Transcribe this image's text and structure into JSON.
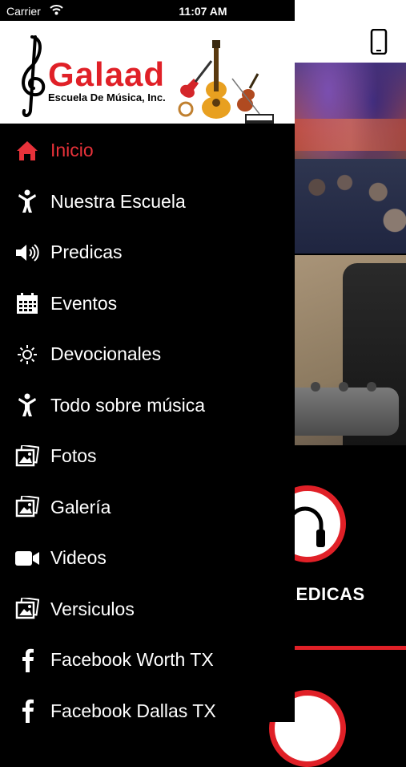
{
  "status_bar": {
    "carrier": "Carrier",
    "time": "11:07 AM"
  },
  "logo": {
    "name": "Galaad",
    "subtitle": "Escuela De Música, Inc."
  },
  "menu": [
    {
      "label": "Inicio",
      "icon": "home-icon",
      "active": true
    },
    {
      "label": "Nuestra Escuela",
      "icon": "person-icon"
    },
    {
      "label": "Predicas",
      "icon": "speaker-icon"
    },
    {
      "label": "Eventos",
      "icon": "calendar-icon"
    },
    {
      "label": "Devocionales",
      "icon": "sun-icon"
    },
    {
      "label": "Todo sobre música",
      "icon": "person-icon"
    },
    {
      "label": "Fotos",
      "icon": "photos-icon"
    },
    {
      "label": "Galería",
      "icon": "photos-icon"
    },
    {
      "label": "Videos",
      "icon": "video-camera-icon"
    },
    {
      "label": "Versiculos",
      "icon": "photos-icon"
    },
    {
      "label": "Facebook Worth TX",
      "icon": "facebook-icon"
    },
    {
      "label": "Facebook Dallas TX",
      "icon": "facebook-icon"
    }
  ],
  "background": {
    "section_label": "PREDICAS"
  },
  "colors": {
    "accent": "#e8323a",
    "drawer_bg": "#000000",
    "logo_red": "#e02027"
  }
}
